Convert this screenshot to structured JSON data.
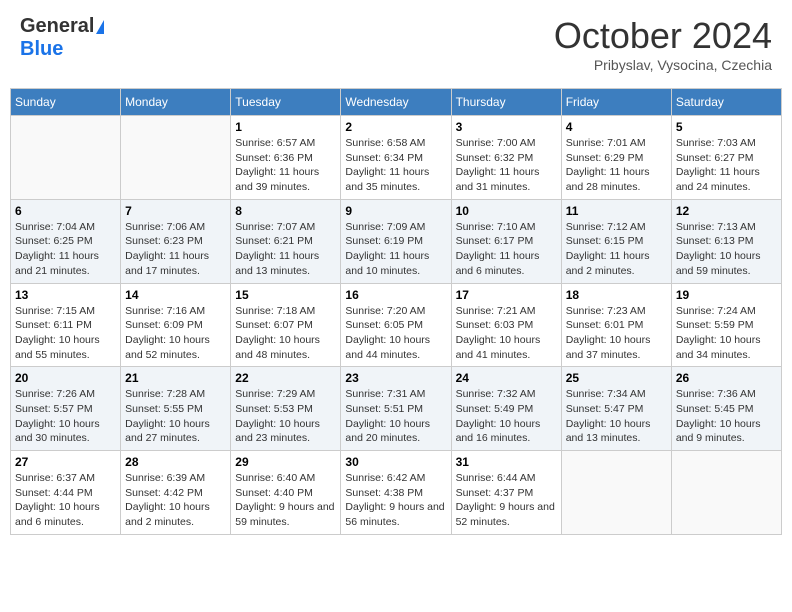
{
  "logo": {
    "general": "General",
    "blue": "Blue"
  },
  "title": "October 2024",
  "location": "Pribyslav, Vysocina, Czechia",
  "days_of_week": [
    "Sunday",
    "Monday",
    "Tuesday",
    "Wednesday",
    "Thursday",
    "Friday",
    "Saturday"
  ],
  "weeks": [
    [
      {
        "day": "",
        "sunrise": "",
        "sunset": "",
        "daylight": ""
      },
      {
        "day": "",
        "sunrise": "",
        "sunset": "",
        "daylight": ""
      },
      {
        "day": "1",
        "sunrise": "Sunrise: 6:57 AM",
        "sunset": "Sunset: 6:36 PM",
        "daylight": "Daylight: 11 hours and 39 minutes."
      },
      {
        "day": "2",
        "sunrise": "Sunrise: 6:58 AM",
        "sunset": "Sunset: 6:34 PM",
        "daylight": "Daylight: 11 hours and 35 minutes."
      },
      {
        "day": "3",
        "sunrise": "Sunrise: 7:00 AM",
        "sunset": "Sunset: 6:32 PM",
        "daylight": "Daylight: 11 hours and 31 minutes."
      },
      {
        "day": "4",
        "sunrise": "Sunrise: 7:01 AM",
        "sunset": "Sunset: 6:29 PM",
        "daylight": "Daylight: 11 hours and 28 minutes."
      },
      {
        "day": "5",
        "sunrise": "Sunrise: 7:03 AM",
        "sunset": "Sunset: 6:27 PM",
        "daylight": "Daylight: 11 hours and 24 minutes."
      }
    ],
    [
      {
        "day": "6",
        "sunrise": "Sunrise: 7:04 AM",
        "sunset": "Sunset: 6:25 PM",
        "daylight": "Daylight: 11 hours and 21 minutes."
      },
      {
        "day": "7",
        "sunrise": "Sunrise: 7:06 AM",
        "sunset": "Sunset: 6:23 PM",
        "daylight": "Daylight: 11 hours and 17 minutes."
      },
      {
        "day": "8",
        "sunrise": "Sunrise: 7:07 AM",
        "sunset": "Sunset: 6:21 PM",
        "daylight": "Daylight: 11 hours and 13 minutes."
      },
      {
        "day": "9",
        "sunrise": "Sunrise: 7:09 AM",
        "sunset": "Sunset: 6:19 PM",
        "daylight": "Daylight: 11 hours and 10 minutes."
      },
      {
        "day": "10",
        "sunrise": "Sunrise: 7:10 AM",
        "sunset": "Sunset: 6:17 PM",
        "daylight": "Daylight: 11 hours and 6 minutes."
      },
      {
        "day": "11",
        "sunrise": "Sunrise: 7:12 AM",
        "sunset": "Sunset: 6:15 PM",
        "daylight": "Daylight: 11 hours and 2 minutes."
      },
      {
        "day": "12",
        "sunrise": "Sunrise: 7:13 AM",
        "sunset": "Sunset: 6:13 PM",
        "daylight": "Daylight: 10 hours and 59 minutes."
      }
    ],
    [
      {
        "day": "13",
        "sunrise": "Sunrise: 7:15 AM",
        "sunset": "Sunset: 6:11 PM",
        "daylight": "Daylight: 10 hours and 55 minutes."
      },
      {
        "day": "14",
        "sunrise": "Sunrise: 7:16 AM",
        "sunset": "Sunset: 6:09 PM",
        "daylight": "Daylight: 10 hours and 52 minutes."
      },
      {
        "day": "15",
        "sunrise": "Sunrise: 7:18 AM",
        "sunset": "Sunset: 6:07 PM",
        "daylight": "Daylight: 10 hours and 48 minutes."
      },
      {
        "day": "16",
        "sunrise": "Sunrise: 7:20 AM",
        "sunset": "Sunset: 6:05 PM",
        "daylight": "Daylight: 10 hours and 44 minutes."
      },
      {
        "day": "17",
        "sunrise": "Sunrise: 7:21 AM",
        "sunset": "Sunset: 6:03 PM",
        "daylight": "Daylight: 10 hours and 41 minutes."
      },
      {
        "day": "18",
        "sunrise": "Sunrise: 7:23 AM",
        "sunset": "Sunset: 6:01 PM",
        "daylight": "Daylight: 10 hours and 37 minutes."
      },
      {
        "day": "19",
        "sunrise": "Sunrise: 7:24 AM",
        "sunset": "Sunset: 5:59 PM",
        "daylight": "Daylight: 10 hours and 34 minutes."
      }
    ],
    [
      {
        "day": "20",
        "sunrise": "Sunrise: 7:26 AM",
        "sunset": "Sunset: 5:57 PM",
        "daylight": "Daylight: 10 hours and 30 minutes."
      },
      {
        "day": "21",
        "sunrise": "Sunrise: 7:28 AM",
        "sunset": "Sunset: 5:55 PM",
        "daylight": "Daylight: 10 hours and 27 minutes."
      },
      {
        "day": "22",
        "sunrise": "Sunrise: 7:29 AM",
        "sunset": "Sunset: 5:53 PM",
        "daylight": "Daylight: 10 hours and 23 minutes."
      },
      {
        "day": "23",
        "sunrise": "Sunrise: 7:31 AM",
        "sunset": "Sunset: 5:51 PM",
        "daylight": "Daylight: 10 hours and 20 minutes."
      },
      {
        "day": "24",
        "sunrise": "Sunrise: 7:32 AM",
        "sunset": "Sunset: 5:49 PM",
        "daylight": "Daylight: 10 hours and 16 minutes."
      },
      {
        "day": "25",
        "sunrise": "Sunrise: 7:34 AM",
        "sunset": "Sunset: 5:47 PM",
        "daylight": "Daylight: 10 hours and 13 minutes."
      },
      {
        "day": "26",
        "sunrise": "Sunrise: 7:36 AM",
        "sunset": "Sunset: 5:45 PM",
        "daylight": "Daylight: 10 hours and 9 minutes."
      }
    ],
    [
      {
        "day": "27",
        "sunrise": "Sunrise: 6:37 AM",
        "sunset": "Sunset: 4:44 PM",
        "daylight": "Daylight: 10 hours and 6 minutes."
      },
      {
        "day": "28",
        "sunrise": "Sunrise: 6:39 AM",
        "sunset": "Sunset: 4:42 PM",
        "daylight": "Daylight: 10 hours and 2 minutes."
      },
      {
        "day": "29",
        "sunrise": "Sunrise: 6:40 AM",
        "sunset": "Sunset: 4:40 PM",
        "daylight": "Daylight: 9 hours and 59 minutes."
      },
      {
        "day": "30",
        "sunrise": "Sunrise: 6:42 AM",
        "sunset": "Sunset: 4:38 PM",
        "daylight": "Daylight: 9 hours and 56 minutes."
      },
      {
        "day": "31",
        "sunrise": "Sunrise: 6:44 AM",
        "sunset": "Sunset: 4:37 PM",
        "daylight": "Daylight: 9 hours and 52 minutes."
      },
      {
        "day": "",
        "sunrise": "",
        "sunset": "",
        "daylight": ""
      },
      {
        "day": "",
        "sunrise": "",
        "sunset": "",
        "daylight": ""
      }
    ]
  ]
}
